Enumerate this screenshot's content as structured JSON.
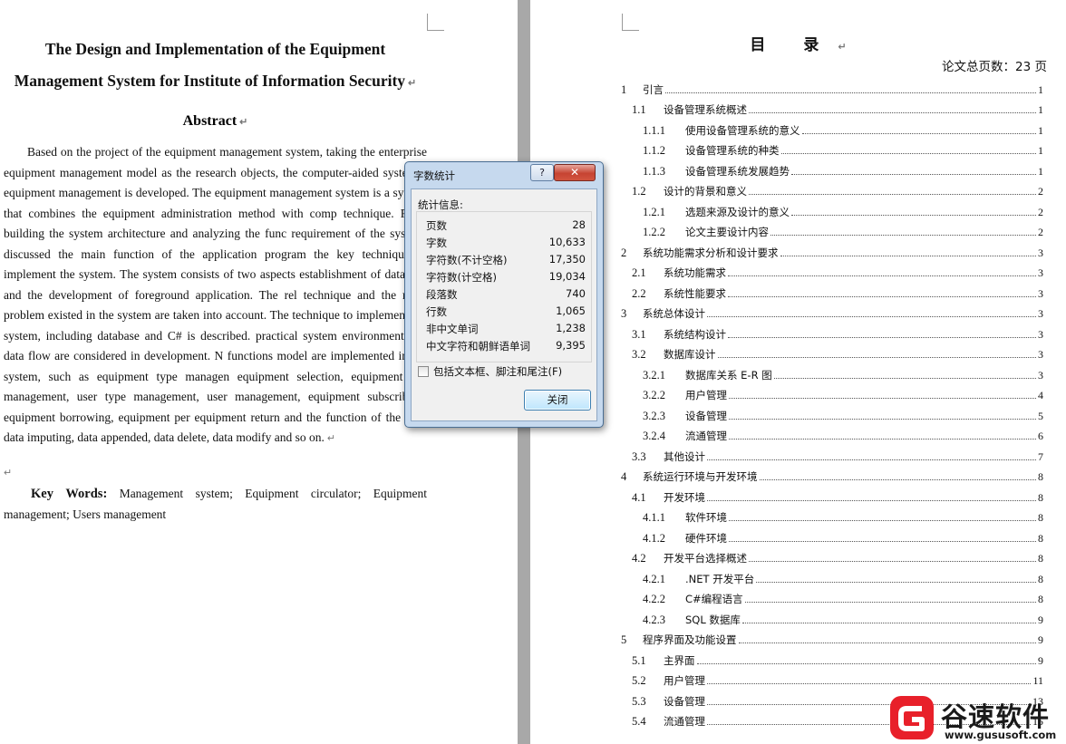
{
  "left_page": {
    "title_line1": "The Design and Implementation of the Equipment",
    "title_line2": "Management System for Institute of Information Security",
    "abstract_heading": "Abstract",
    "abstract_body": "Based on the project of the equipment management system, taking the enterprise equipment management model as the research objects, the computer-aided syste the equipment management is developed. The equipment management system is a system that combines the equipment administration method with comp technique. From building the system architecture and analyzing the func requirement of the system, discussed the main function of the application program the key technique to implement the system. The system consists of two aspects establishment of database and the development of foreground application. The rel technique and the main problem existed in the system are taken into account. The technique to implement the system, including database and C# is described. practical system environment and data flow are considered in development. N functions model are implemented in the system, such as equipment type managen equipment selection, equipment file management, user type management, user management, equipment subscribing, equipment borrowing, equipment per equipment return and the function of the very data imputing, data appended, data delete, data modify and so on.",
    "keywords_label": "Key Words:",
    "keywords_text": "Management system; Equipment circulator; Equipment management; Users management",
    "para_mark": "↵"
  },
  "right_page": {
    "toc_title": "目 录",
    "total_pages": "论文总页数：23 页",
    "toc": [
      {
        "level": 1,
        "num": "1",
        "text": "引言",
        "page": "1"
      },
      {
        "level": 2,
        "num": "1.1",
        "text": "设备管理系统概述",
        "page": "1"
      },
      {
        "level": 3,
        "num": "1.1.1",
        "text": "使用设备管理系统的意义",
        "page": "1"
      },
      {
        "level": 3,
        "num": "1.1.2",
        "text": "设备管理系统的种类",
        "page": "1"
      },
      {
        "level": 3,
        "num": "1.1.3",
        "text": "设备管理系统发展趋势",
        "page": "1"
      },
      {
        "level": 2,
        "num": "1.2",
        "text": "设计的背景和意义",
        "page": "2"
      },
      {
        "level": 3,
        "num": "1.2.1",
        "text": "选题来源及设计的意义",
        "page": "2"
      },
      {
        "level": 3,
        "num": "1.2.2",
        "text": "论文主要设计内容",
        "page": "2"
      },
      {
        "level": 1,
        "num": "2",
        "text": "系统功能需求分析和设计要求",
        "page": "3"
      },
      {
        "level": 2,
        "num": "2.1",
        "text": "系统功能需求",
        "page": "3"
      },
      {
        "level": 2,
        "num": "2.2",
        "text": "系统性能要求",
        "page": "3"
      },
      {
        "level": 1,
        "num": "3",
        "text": "系统总体设计",
        "page": "3"
      },
      {
        "level": 2,
        "num": "3.1",
        "text": "系统结构设计",
        "page": "3"
      },
      {
        "level": 2,
        "num": "3.2",
        "text": "数据库设计",
        "page": "3"
      },
      {
        "level": 3,
        "num": "3.2.1",
        "text": "数据库关系 E-R 图",
        "page": "3"
      },
      {
        "level": 3,
        "num": "3.2.2",
        "text": "用户管理",
        "page": "4"
      },
      {
        "level": 3,
        "num": "3.2.3",
        "text": "设备管理",
        "page": "5"
      },
      {
        "level": 3,
        "num": "3.2.4",
        "text": "流通管理",
        "page": "6"
      },
      {
        "level": 2,
        "num": "3.3",
        "text": "其他设计",
        "page": "7"
      },
      {
        "level": 1,
        "num": "4",
        "text": "系统运行环境与开发环境",
        "page": "8"
      },
      {
        "level": 2,
        "num": "4.1",
        "text": "开发环境",
        "page": "8"
      },
      {
        "level": 3,
        "num": "4.1.1",
        "text": "软件环境",
        "page": "8"
      },
      {
        "level": 3,
        "num": "4.1.2",
        "text": "硬件环境",
        "page": "8"
      },
      {
        "level": 2,
        "num": "4.2",
        "text": "开发平台选择概述",
        "page": "8"
      },
      {
        "level": 3,
        "num": "4.2.1",
        "text": ".NET 开发平台",
        "page": "8"
      },
      {
        "level": 3,
        "num": "4.2.2",
        "text": "C#编程语言",
        "page": "8"
      },
      {
        "level": 3,
        "num": "4.2.3",
        "text": "SQL 数据库",
        "page": "9"
      },
      {
        "level": 1,
        "num": "5",
        "text": "程序界面及功能设置",
        "page": "9"
      },
      {
        "level": 2,
        "num": "5.1",
        "text": "主界面",
        "page": "9"
      },
      {
        "level": 2,
        "num": "5.2",
        "text": "用户管理",
        "page": "11"
      },
      {
        "level": 2,
        "num": "5.3",
        "text": "设备管理",
        "page": "13"
      },
      {
        "level": 2,
        "num": "5.4",
        "text": "流通管理",
        "page": "15"
      }
    ]
  },
  "dialog": {
    "title": "字数统计",
    "help_label": "?",
    "close_x_label": "✕",
    "stats_label": "统计信息:",
    "stats": [
      {
        "label": "页数",
        "value": "28"
      },
      {
        "label": "字数",
        "value": "10,633"
      },
      {
        "label": "字符数(不计空格)",
        "value": "17,350"
      },
      {
        "label": "字符数(计空格)",
        "value": "19,034"
      },
      {
        "label": "段落数",
        "value": "740"
      },
      {
        "label": "行数",
        "value": "1,065"
      },
      {
        "label": "非中文单词",
        "value": "1,238"
      },
      {
        "label": "中文字符和朝鲜语单词",
        "value": "9,395"
      }
    ],
    "checkbox_label": "包括文本框、脚注和尾注(F)",
    "checkbox_checked": false,
    "close_button_label": "关闭"
  },
  "watermark": {
    "brand": "谷速软件",
    "url": "www.gususoft.com",
    "brand_color": "#e8202a"
  }
}
